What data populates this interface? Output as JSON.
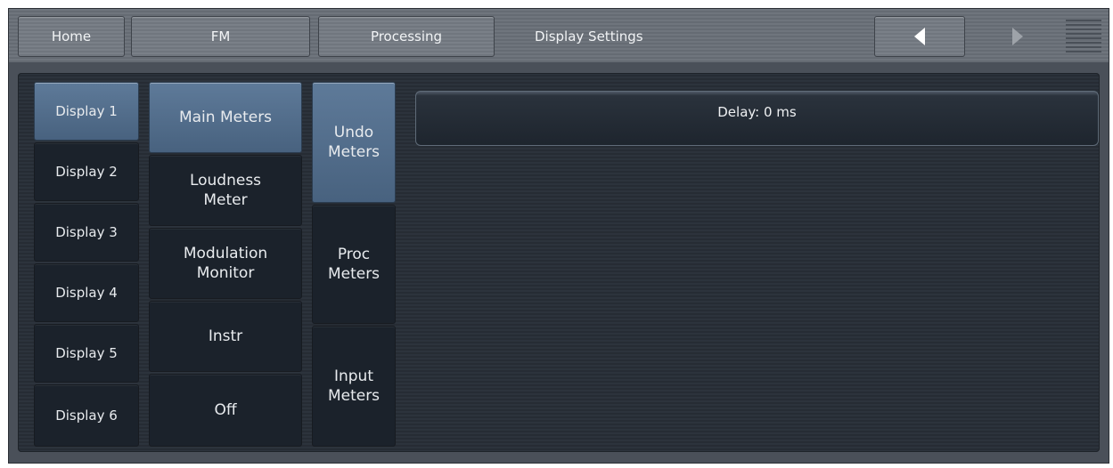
{
  "topbar": {
    "home": "Home",
    "fm": "FM",
    "processing": "Processing",
    "current_page": "Display Settings",
    "icons": {
      "back": "left-arrow-icon",
      "forward": "right-arrow-icon",
      "menu": "menu-icon"
    }
  },
  "displays": [
    "Display 1",
    "Display 2",
    "Display 3",
    "Display 4",
    "Display 5",
    "Display 6"
  ],
  "selected_display": "Display 1",
  "meter_types": [
    "Main Meters",
    "Loudness\nMeter",
    "Modulation\nMonitor",
    "Instr",
    "Off"
  ],
  "selected_meter_type": "Main Meters",
  "meter_groups": [
    "Undo\nMeters",
    "Proc\nMeters",
    "Input\nMeters"
  ],
  "selected_meter_group": "Undo Meters",
  "delay": {
    "label": "Delay: 0 ms"
  },
  "colors": {
    "selected": "#56718f",
    "button": "#1b222b",
    "panel": "#2a3139"
  }
}
